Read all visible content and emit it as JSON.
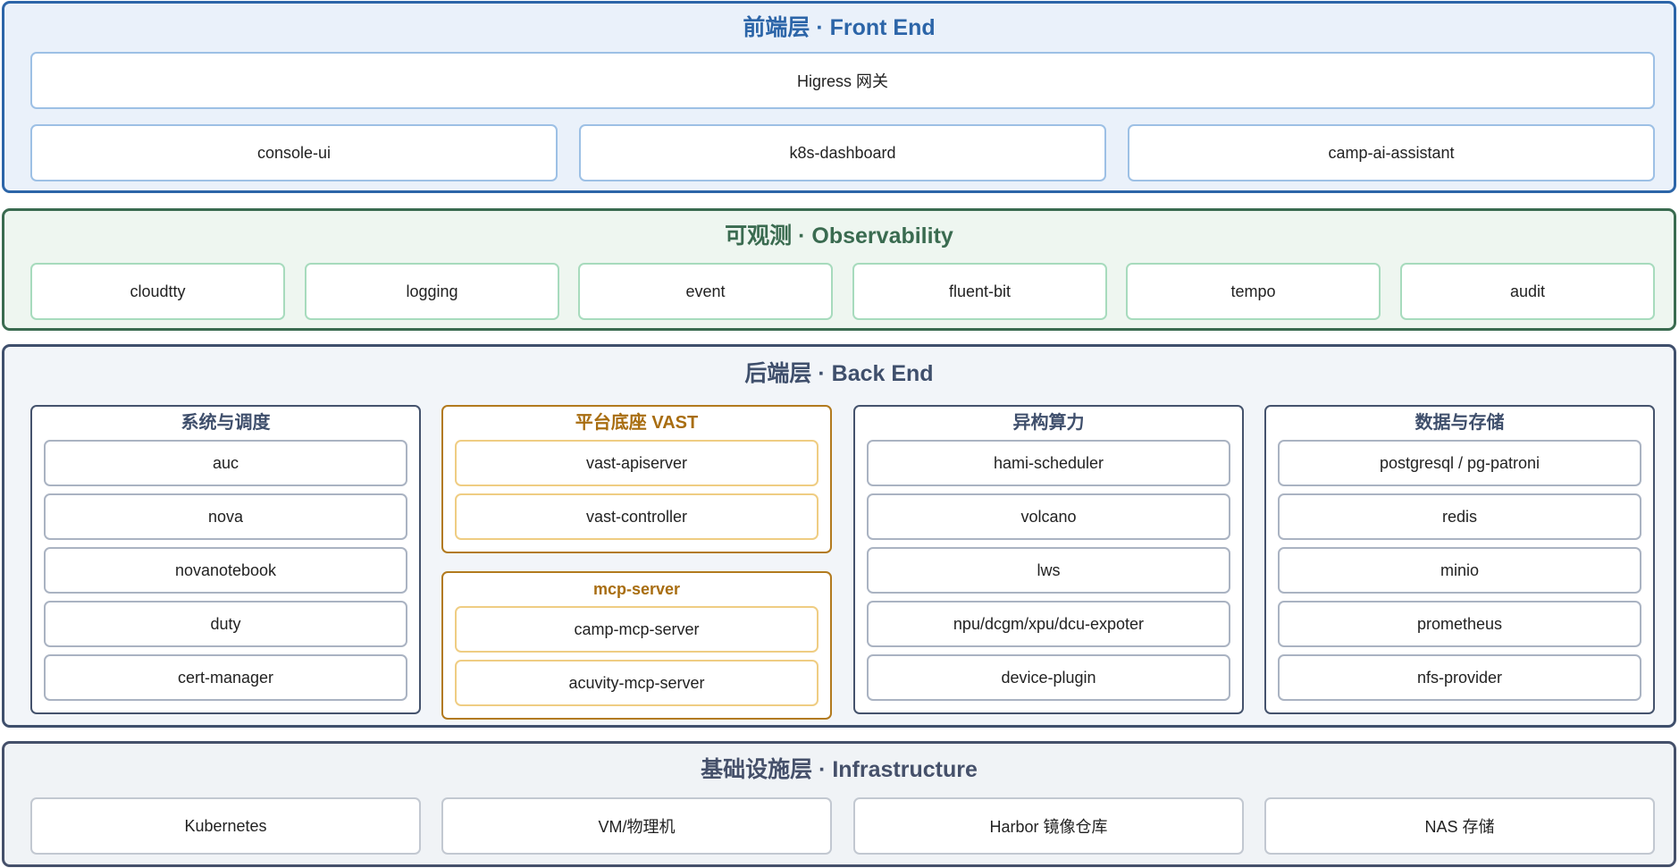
{
  "front_end": {
    "title_cn": "前端层",
    "title_en": "Front End",
    "gateway": "Higress 网关",
    "apps": [
      "console-ui",
      "k8s-dashboard",
      "camp-ai-assistant"
    ]
  },
  "observability": {
    "title_cn": "可观测",
    "title_en": "Observability",
    "items": [
      "cloudtty",
      "logging",
      "event",
      "fluent-bit",
      "tempo",
      "audit"
    ]
  },
  "back_end": {
    "title_cn": "后端层",
    "title_en": "Back End",
    "system": {
      "title": "系统与调度",
      "items": [
        "auc",
        "nova",
        "novanotebook",
        "duty",
        "cert-manager"
      ]
    },
    "platform": {
      "title": "平台底座 VAST",
      "items": [
        "vast-apiserver",
        "vast-controller"
      ]
    },
    "mcp": {
      "title": "mcp-server",
      "items": [
        "camp-mcp-server",
        "acuvity-mcp-server"
      ]
    },
    "compute": {
      "title": "异构算力",
      "items": [
        "hami-scheduler",
        "volcano",
        "lws",
        "npu/dcgm/xpu/dcu-expoter",
        "device-plugin"
      ]
    },
    "storage": {
      "title": "数据与存储",
      "items": [
        "postgresql / pg-patroni",
        "redis",
        "minio",
        "prometheus",
        "nfs-provider"
      ]
    }
  },
  "infrastructure": {
    "title_cn": "基础设施层",
    "title_en": "Infrastructure",
    "items": [
      "Kubernetes",
      "VM/物理机",
      "Harbor 镜像仓库",
      "NAS 存储"
    ]
  },
  "colors": {
    "front_end": "#2c65a8",
    "observability": "#3a6b50",
    "back_end": "#3f4f6c",
    "platform_accent": "#b27a1e",
    "infrastructure": "#45506a"
  }
}
